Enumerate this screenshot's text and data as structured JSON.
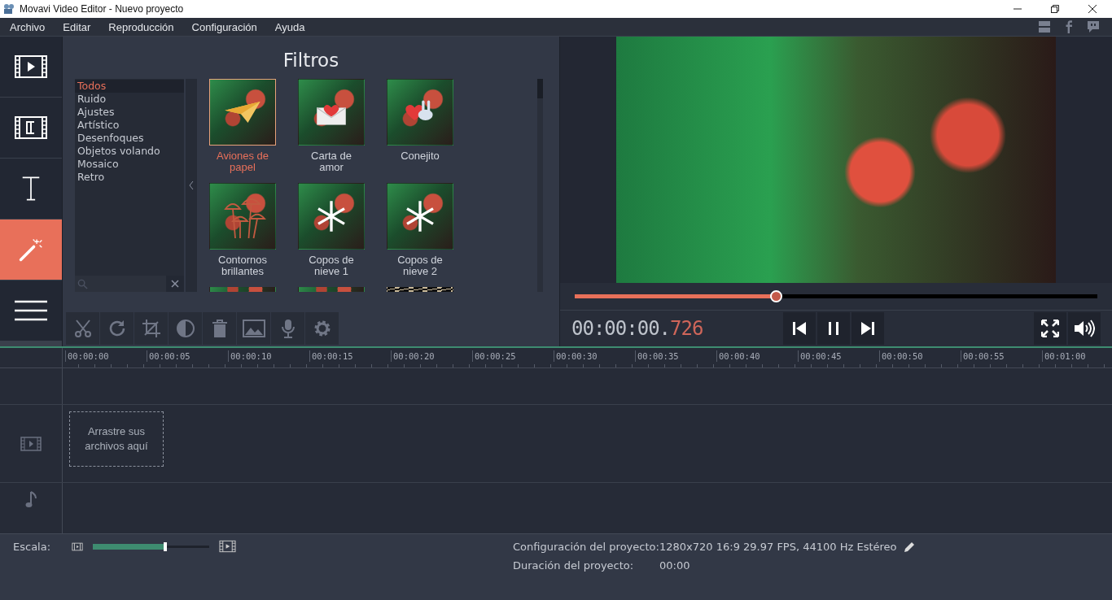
{
  "window": {
    "title": "Movavi Video Editor - Nuevo proyecto"
  },
  "menu": [
    "Archivo",
    "Editar",
    "Reproducción",
    "Configuración",
    "Ayuda"
  ],
  "sidebar": [
    {
      "kind": "media",
      "selected": false
    },
    {
      "kind": "transitions",
      "selected": false
    },
    {
      "kind": "titles",
      "selected": false
    },
    {
      "kind": "filters",
      "selected": true
    },
    {
      "kind": "more",
      "selected": false
    }
  ],
  "filters_panel": {
    "title": "Filtros",
    "categories": [
      {
        "label": "Todos",
        "selected": true
      },
      {
        "label": "Ruido",
        "selected": false
      },
      {
        "label": "Ajustes",
        "selected": false
      },
      {
        "label": "Artístico",
        "selected": false
      },
      {
        "label": "Desenfoques",
        "selected": false
      },
      {
        "label": "Objetos volando",
        "selected": false
      },
      {
        "label": "Mosaico",
        "selected": false
      },
      {
        "label": "Retro",
        "selected": false
      }
    ],
    "items": [
      {
        "label": "Aviones de papel",
        "kind": "plane",
        "selected": true
      },
      {
        "label": "Carta de amor",
        "kind": "letter",
        "selected": false
      },
      {
        "label": "Conejito",
        "kind": "bunny",
        "selected": false
      },
      {
        "label": "Contornos brillantes",
        "kind": "outline",
        "selected": false
      },
      {
        "label": "Copos de nieve 1",
        "kind": "snow",
        "selected": false
      },
      {
        "label": "Copos de nieve 2",
        "kind": "snow",
        "selected": false
      }
    ],
    "partial_row": [
      {
        "kind": "plane"
      },
      {
        "kind": "letter"
      },
      {
        "kind": "rings"
      }
    ]
  },
  "player": {
    "seek": {
      "level": 0.385
    },
    "timecode": {
      "main": "00:00:00.",
      "fraction": "726"
    }
  },
  "timeline": {
    "ruler": [
      "00:00:00",
      "00:00:05",
      "00:00:10",
      "00:00:15",
      "00:00:20",
      "00:00:25",
      "00:00:30",
      "00:00:35",
      "00:00:40",
      "00:00:45",
      "00:00:50",
      "00:00:55",
      "00:01:00"
    ],
    "drop_hint": "Arrastre sus archivos aquí"
  },
  "status_bar": {
    "scale_label": "Escala:",
    "scale": {
      "level": 0.62
    },
    "config_label": "Configuración del proyecto:",
    "config_value": "1280x720 16:9 29.97 FPS, 44100 Hz Estéreo",
    "duration_label": "Duración del proyecto:",
    "duration_value": "00:00"
  }
}
